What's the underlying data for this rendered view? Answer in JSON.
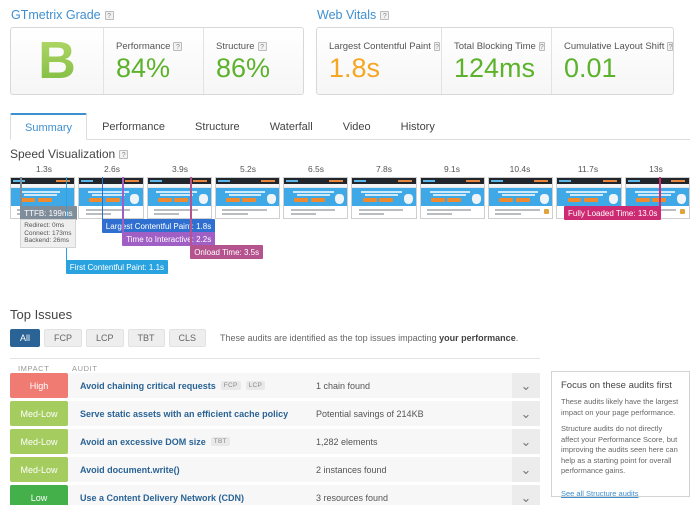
{
  "grade_section": {
    "title": "GTmetrix Grade",
    "help_icon": "question-mark-icon",
    "grade": "B",
    "metrics": [
      {
        "label": "Performance",
        "value": "84%"
      },
      {
        "label": "Structure",
        "value": "86%"
      }
    ]
  },
  "web_vitals": {
    "title": "Web Vitals",
    "metrics": [
      {
        "label": "Largest Contentful Paint",
        "value": "1.8s",
        "color": "#f5a623"
      },
      {
        "label": "Total Blocking Time",
        "value": "124ms",
        "color": "#5cb32b"
      },
      {
        "label": "Cumulative Layout Shift",
        "value": "0.01",
        "color": "#5cb32b"
      }
    ]
  },
  "tabs": [
    {
      "label": "Summary",
      "active": true
    },
    {
      "label": "Performance",
      "active": false
    },
    {
      "label": "Structure",
      "active": false
    },
    {
      "label": "Waterfall",
      "active": false
    },
    {
      "label": "Video",
      "active": false
    },
    {
      "label": "History",
      "active": false
    }
  ],
  "speed_visualization": {
    "title": "Speed Visualization",
    "ticks": [
      "1.3s",
      "2.6s",
      "3.9s",
      "5.2s",
      "6.5s",
      "7.8s",
      "9.1s",
      "10.4s",
      "11.7s",
      "13s"
    ],
    "frame_count": 10,
    "events": [
      {
        "name": "TTFB",
        "label": "TTFB: 199ms",
        "color": "#7f8c9a",
        "x_pct": 1.5
      },
      {
        "name": "First Contentful Paint",
        "label": "First Contentful Paint: 1.1s",
        "color": "#29a3e0",
        "x_pct": 8.2
      },
      {
        "name": "Largest Contentful Paint",
        "label": "Largest Contentful Paint: 1.8s",
        "color": "#2f6fd0",
        "x_pct": 13.5
      },
      {
        "name": "Time to Interactive",
        "label": "Time to Interactive: 2.2s",
        "color": "#a05fc4",
        "x_pct": 16.5
      },
      {
        "name": "Onload Time",
        "label": "Onload Time: 3.5s",
        "color": "#b5538e",
        "x_pct": 26.5
      },
      {
        "name": "Fully Loaded Time",
        "label": "Fully Loaded Time: 13.0s",
        "color": "#cc2a72",
        "x_pct": 95.5
      }
    ],
    "ttfb_breakdown": [
      "Redirect: 0ms",
      "Connect: 173ms",
      "Backend: 26ms"
    ]
  },
  "top_issues": {
    "title": "Top Issues",
    "filters": [
      {
        "label": "All",
        "active": true
      },
      {
        "label": "FCP",
        "active": false
      },
      {
        "label": "LCP",
        "active": false
      },
      {
        "label": "TBT",
        "active": false
      },
      {
        "label": "CLS",
        "active": false
      }
    ],
    "note_prefix": "These audits are identified as the top issues impacting ",
    "note_bold": "your performance",
    "note_suffix": ".",
    "columns": {
      "impact": "IMPACT",
      "audit": "AUDIT"
    },
    "rows": [
      {
        "impact": "High",
        "impact_class": "imp-high",
        "audit": "Avoid chaining critical requests",
        "tags": [
          "FCP",
          "LCP"
        ],
        "detail": "1 chain found",
        "chevron": "chevron-down-icon"
      },
      {
        "impact": "Med-Low",
        "impact_class": "imp-medlow",
        "audit": "Serve static assets with an efficient cache policy",
        "tags": [],
        "detail": "Potential savings of 214KB",
        "chevron": "chevron-down-icon"
      },
      {
        "impact": "Med-Low",
        "impact_class": "imp-medlow",
        "audit": "Avoid an excessive DOM size",
        "tags": [
          "TBT"
        ],
        "detail": "1,282 elements",
        "chevron": "chevron-down-icon"
      },
      {
        "impact": "Med-Low",
        "impact_class": "imp-medlow",
        "audit": "Avoid document.write()",
        "tags": [],
        "detail": "2 instances found",
        "chevron": "chevron-down-icon"
      },
      {
        "impact": "Low",
        "impact_class": "imp-low",
        "audit": "Use a Content Delivery Network (CDN)",
        "tags": [],
        "detail": "3 resources found",
        "chevron": "chevron-down-icon"
      }
    ]
  },
  "focus_panel": {
    "title": "Focus on these audits first",
    "paragraph_1": "These audits likely have the largest impact on your page performance.",
    "paragraph_2": "Structure audits do not directly affect your Performance Score, but improving the audits seen here can help as a starting point for overall performance gains.",
    "link": "See all Structure audits"
  }
}
